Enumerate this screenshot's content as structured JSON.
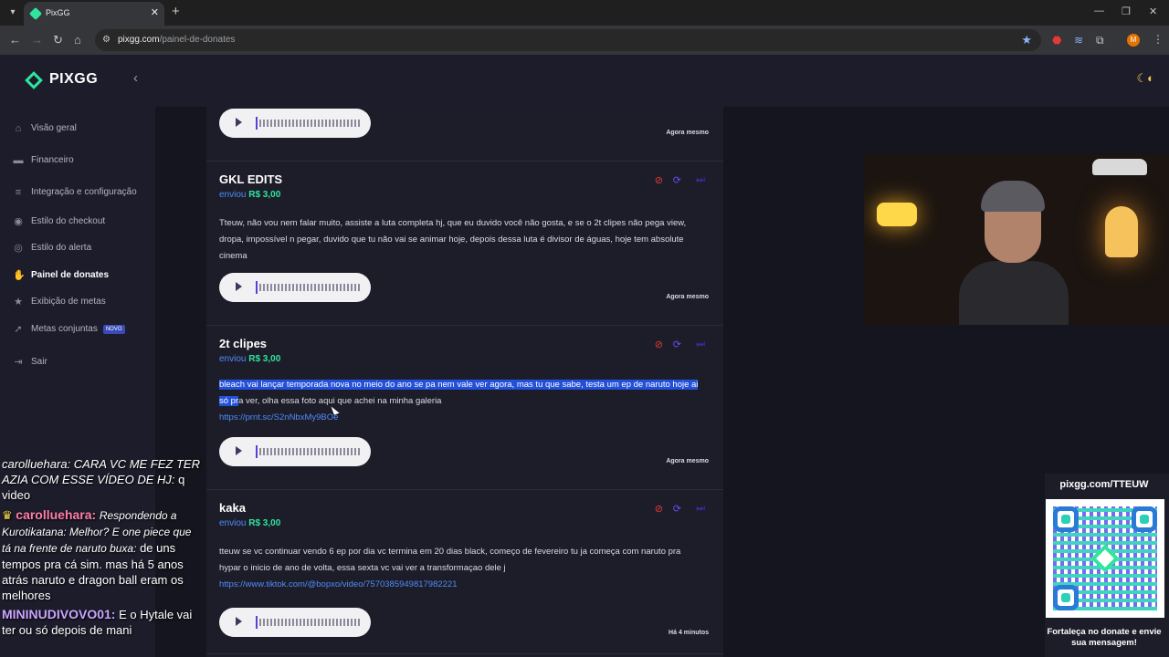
{
  "browser": {
    "tab_title": "PixGG",
    "url_host": "pixgg.com",
    "url_path": "/painel-de-donates",
    "new_tab": "+",
    "close": "✕"
  },
  "sidebar": {
    "brand": "PIXGG",
    "items": [
      {
        "label": "Visão geral",
        "icon": "home-icon"
      },
      {
        "label": "Financeiro",
        "icon": "wallet-icon"
      },
      {
        "label": "Integração e configuração",
        "icon": "settings-icon"
      },
      {
        "label": "Estilo do checkout",
        "icon": "palette-icon"
      },
      {
        "label": "Estilo do alerta",
        "icon": "palette-icon"
      },
      {
        "label": "Painel de donates",
        "icon": "donate-hand-icon"
      },
      {
        "label": "Exibição de metas",
        "icon": "star-icon"
      },
      {
        "label": "Metas conjuntas",
        "icon": "rocket-icon",
        "badge": "NOVO"
      },
      {
        "label": "Sair",
        "icon": "logout-icon"
      }
    ]
  },
  "donates": [
    {
      "name": "",
      "sent_label": "",
      "amount": "",
      "message": "",
      "time": "Agora mesmo"
    },
    {
      "name": "GKL EDITS",
      "sent_label": "enviou",
      "amount": "R$ 3,00",
      "message": "Tteuw, não vou nem falar muito, assiste a luta completa hj, que eu duvido você não gosta, e se o 2t clipes não pega view, dropa, impossível n pegar, duvido que tu não vai se animar hoje, depois dessa luta é divisor de águas, hoje tem absolute cinema",
      "time": "Agora mesmo"
    },
    {
      "name": "2t clipes",
      "sent_label": "enviou",
      "amount": "R$ 3,00",
      "message_highlight": "bleach vai lançar temporada nova no meio do ano se pa nem vale ver agora, mas tu que sabe, testa um ep de naruto hoje ai só pr",
      "message_rest": "a ver, olha essa foto aqui que achei na minha galeria",
      "link": "https://prnt.sc/S2nNbxMy9BOe",
      "time": "Agora mesmo"
    },
    {
      "name": "kaka",
      "sent_label": "enviou",
      "amount": "R$ 3,00",
      "message": "tteuw se vc continuar vendo 6 ep por dia vc termina em 20 dias black, começo de fevereiro tu ja começa com naruto pra hypar o inicio de ano de volta, essa sexta vc vai ver a transformaçao dele j",
      "link": "https://www.tiktok.com/@bopxo/video/7570385949817982221",
      "time": "Há 4 minutos"
    }
  ],
  "chat": {
    "line1_user": "carolluehara:",
    "line1_msg": "CARA VC ME FEZ TER AZIA COM ESSE VÍDEO DE HJ:",
    "line1_tail": "q video",
    "line2_user": "carolluehara:",
    "line2_reply": "Respondendo a Kurotikatana: Melhor? E one piece que tá na frente de naruto buxa:",
    "line2_msg": "de uns tempos pra cá sim. mas há 5 anos atrás naruto e dragon ball eram os melhores",
    "line3_user": "MININUDIVOVO01:",
    "line3_msg": "E o Hytale vai ter ou só depois de mani"
  },
  "qr": {
    "title": "pixgg.com/TTEUW",
    "footer": "Fortaleça no donate e envie sua mensagem!"
  },
  "colors": {
    "accent_green": "#2ee59d",
    "link_blue": "#4f8cf7",
    "highlight": "#2350d9",
    "page_bg": "#15151f"
  }
}
